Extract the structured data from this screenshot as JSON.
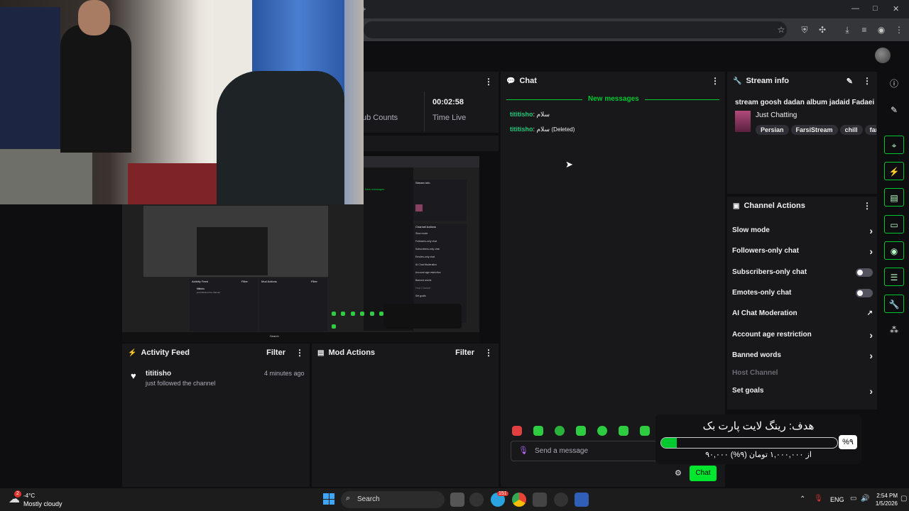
{
  "browser": {
    "new_tab_glyph": "+",
    "minimize": "—",
    "maximize": "□",
    "close": "✕"
  },
  "stats": {
    "time_value": "00:02:58",
    "time_label": "Time Live",
    "sub_label": "ub Counts"
  },
  "chat": {
    "title": "Chat",
    "new_messages": "New messages",
    "messages": [
      {
        "user": "tititisho",
        "text": ": سلام",
        "deleted": ""
      },
      {
        "user": "tititisho",
        "text": ": سلام",
        "deleted": "(Deleted)"
      }
    ],
    "input_placeholder": "Send a message",
    "send_label": "Chat"
  },
  "stream_info": {
    "title": "Stream info",
    "stream_title": "stream goosh dadan album jadaid Fadaei",
    "category": "Just Chatting",
    "tags": [
      "Persian",
      "FarsiStream",
      "chill",
      "farsi"
    ]
  },
  "channel_actions": {
    "title": "Channel Actions",
    "items": [
      {
        "label": "Slow mode",
        "control": "chevron"
      },
      {
        "label": "Followers-only chat",
        "control": "chevron"
      },
      {
        "label": "Subscribers-only chat",
        "control": "toggle"
      },
      {
        "label": "Emotes-only chat",
        "control": "toggle"
      },
      {
        "label": "AI Chat Moderation",
        "control": "external"
      },
      {
        "label": "Account age restriction",
        "control": "chevron"
      },
      {
        "label": "Banned words",
        "control": "chevron"
      },
      {
        "label": "Host Channel",
        "control": "disabled"
      },
      {
        "label": "Set goals",
        "control": "chevron"
      }
    ]
  },
  "activity_feed": {
    "title": "Activity Feed",
    "filter": "Filter",
    "items": [
      {
        "user": "tititisho",
        "time": "4 minutes ago",
        "action": "just followed the channel"
      }
    ]
  },
  "mod_actions": {
    "title": "Mod Actions",
    "filter": "Filter"
  },
  "goal_overlay": {
    "title": "هدف: رینگ لایت پارت بک",
    "percent_label": "%۹",
    "progress_text": "۹۰,۰۰۰ از ۱,۰۰۰,۰۰۰ تومان (۹%)",
    "progress": 0.09
  },
  "taskbar": {
    "weather_temp": "-4°C",
    "weather_desc": "Mostly cloudy",
    "weather_badge": "2",
    "search": "Search",
    "lang": "ENG",
    "time": "2:54 PM",
    "date": "1/5/2026",
    "telegram_badge": "151"
  },
  "embedded_screen": {
    "stream_info": "Stream info",
    "channel_actions": "Channel Actions",
    "activity_feed": "Activity Feed",
    "mod_actions": "Mod Actions",
    "filter": "Filter",
    "new_messages": "New messages",
    "mini_items": [
      "Slow mode",
      "Followers-only chat",
      "Subscribers-only chat",
      "Emotes-only chat",
      "AI Chat Moderation",
      "Account age restriction",
      "Banned words",
      "Host Channel",
      "Set goals"
    ],
    "feed_user": "tititisho",
    "feed_action": "just followed the channel",
    "search": "Search"
  },
  "colors": {
    "accent": "#00c82f",
    "chat_user": "#21c97a",
    "panel": "#18181b",
    "background": "#0e0e10"
  }
}
